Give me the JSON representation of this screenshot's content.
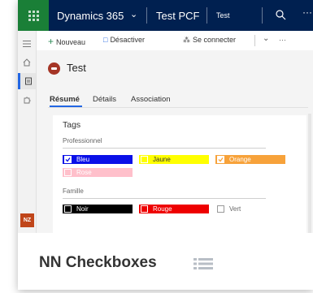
{
  "topbar": {
    "brand": "Dynamics 365",
    "app_name": "Test PCF",
    "area_name": "Test",
    "more_label": "···"
  },
  "nav": {
    "user_initials": "NZ"
  },
  "commands": {
    "new_label": "Nouveau",
    "deactivate_label": "Désactiver",
    "connect_label": "Se connecter",
    "more_label": "···"
  },
  "record": {
    "title": "Test",
    "tabs": [
      {
        "label": "Résumé"
      },
      {
        "label": "Détails"
      },
      {
        "label": "Association"
      }
    ]
  },
  "section": {
    "title": "Tags",
    "groups": [
      {
        "label": "Professionnel",
        "options": [
          {
            "label": "Bleu",
            "checked": true,
            "bg": "#0a10e8",
            "fg": "#ffffff"
          },
          {
            "label": "Jaune",
            "checked": false,
            "bg": "#ffff00",
            "fg": "#333333"
          },
          {
            "label": "Orange",
            "checked": true,
            "bg": "#f7a23a",
            "fg": "#ffffff"
          },
          {
            "label": "Rose",
            "checked": false,
            "bg": "#ffc0cb",
            "fg": "#ffffff"
          }
        ]
      },
      {
        "label": "Famille",
        "options": [
          {
            "label": "Noir",
            "checked": false,
            "bg": "#000000",
            "fg": "#ffffff"
          },
          {
            "label": "Rouge",
            "checked": false,
            "bg": "#ee0000",
            "fg": "#ffffff"
          },
          {
            "label": "Vert",
            "checked": false,
            "bg": "#ffffff",
            "fg": "#666666"
          }
        ]
      }
    ]
  },
  "caption": {
    "title": "NN Checkboxes"
  },
  "colors": {
    "topbar": "#002050",
    "waffle": "#1a7f37",
    "accent": "#2266e3"
  }
}
